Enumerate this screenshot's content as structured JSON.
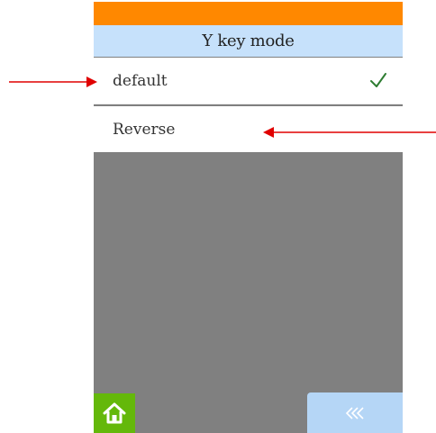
{
  "header": {
    "title": "Y key mode"
  },
  "options": [
    {
      "label": "default",
      "selected": true
    },
    {
      "label": "Reverse",
      "selected": false
    }
  ],
  "footer": {
    "home_icon": "home-icon",
    "back_icon": "double-chevron-left-icon"
  },
  "colors": {
    "top_bar": "#ff8800",
    "title_bar": "#c6e1fb",
    "background": "#808080",
    "check": "#2e7d32",
    "home_button": "#64b80a",
    "back_button": "#b5d6f6",
    "annotation_arrow": "#e00000"
  }
}
